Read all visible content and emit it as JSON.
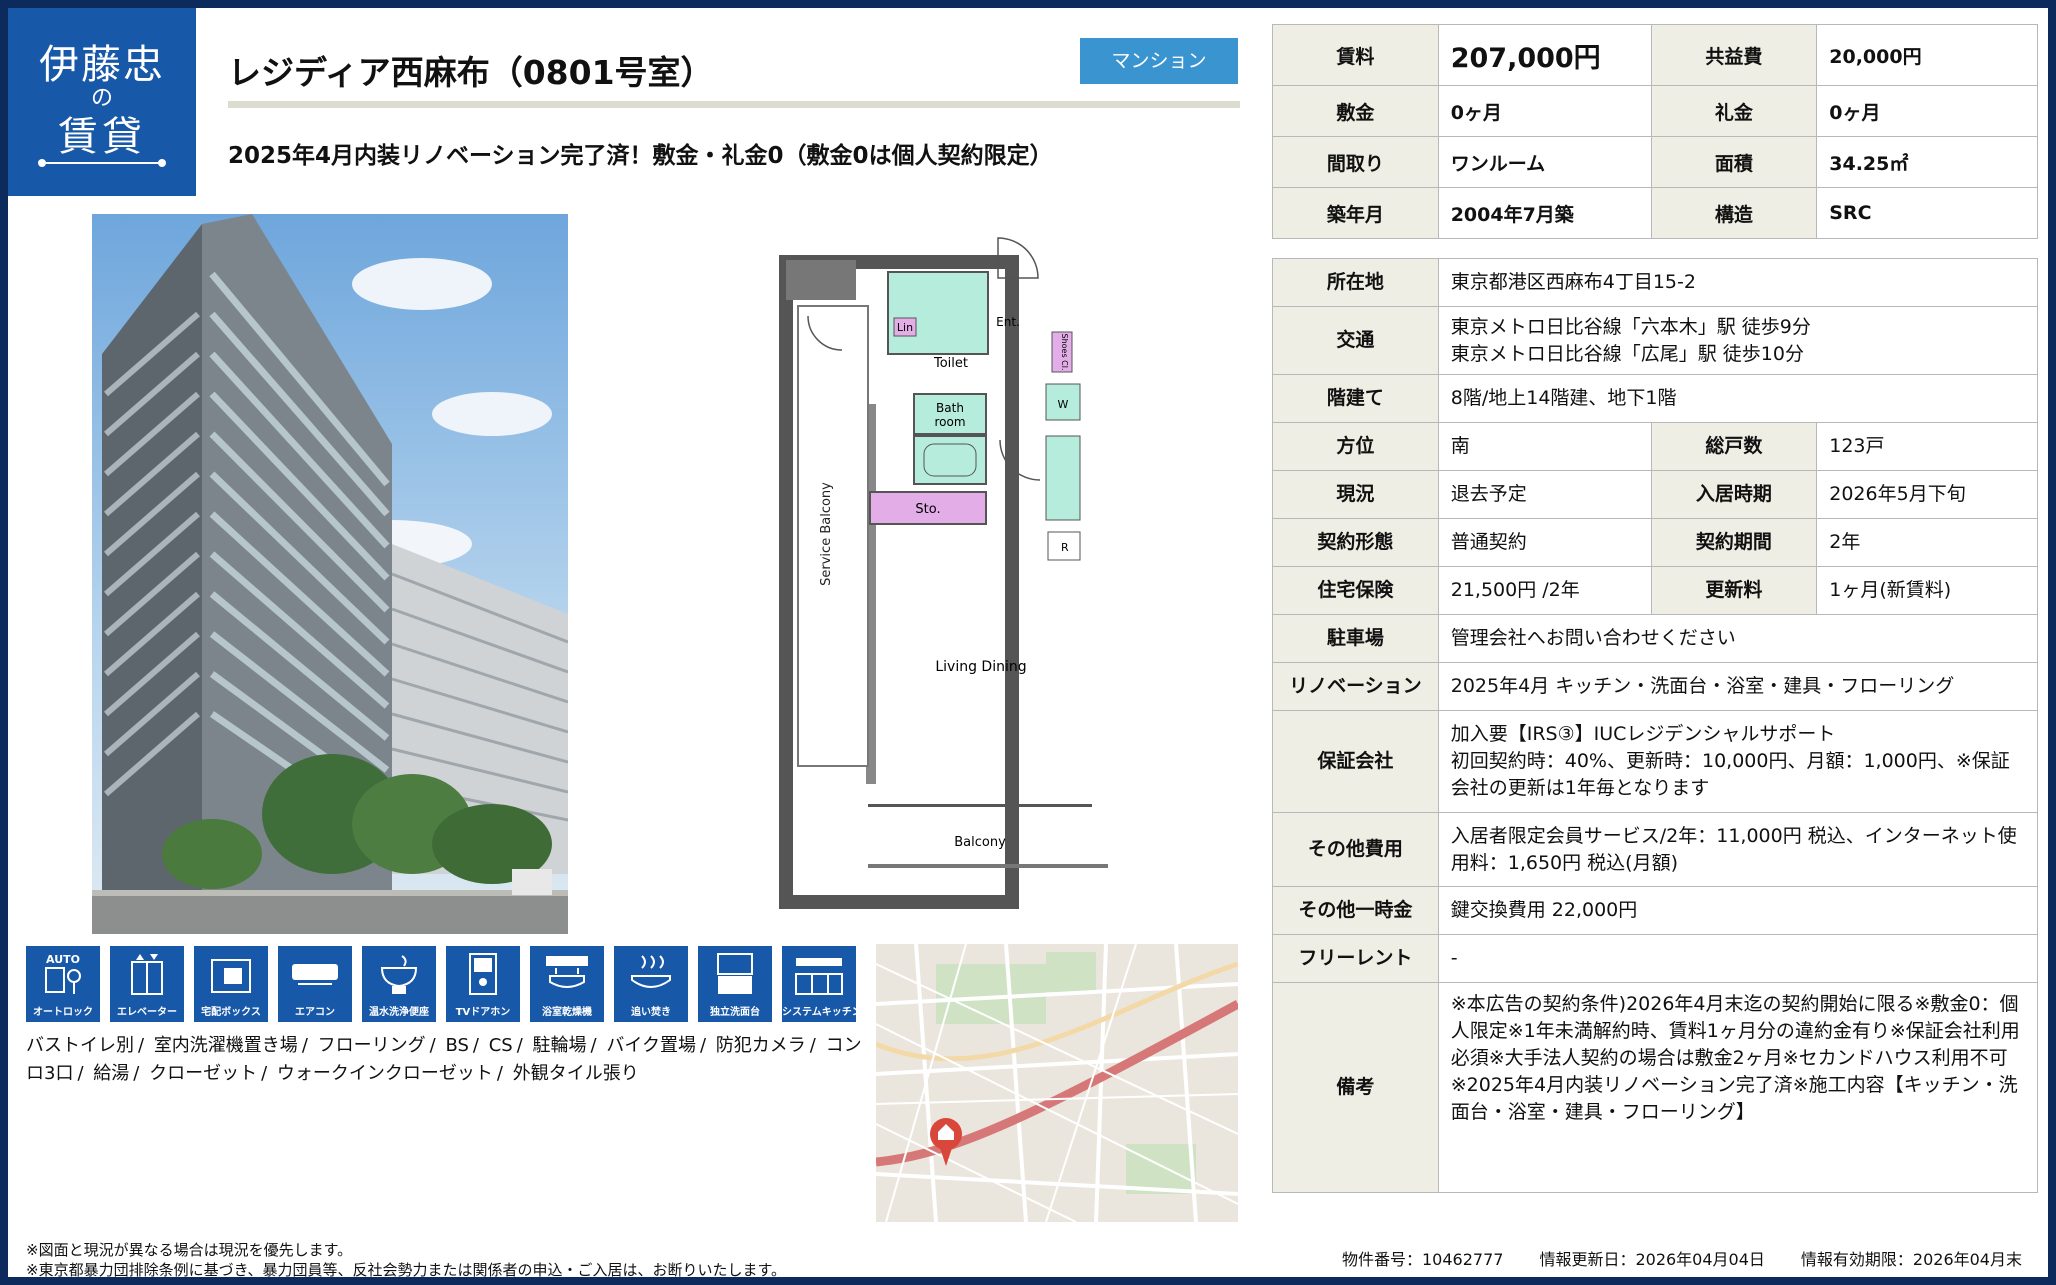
{
  "logo": {
    "line1": "伊藤忠",
    "line2": "の",
    "line3": "賃貸"
  },
  "title": "レジディア西麻布（0801号室）",
  "badge": "マンション",
  "subtitle": "2025年4月内装リノベーション完了済！敷金・礼金0（敷金0は個人契約限定）",
  "floorplan": {
    "lin": "Lin",
    "ent": "Ent.",
    "toilet": "Toilet",
    "shoes": "Shoes Cl.",
    "bath1": "Bath",
    "bath2": "room",
    "w": "W",
    "sto": "Sto.",
    "r": "R",
    "service_balcony": "Service Balcony",
    "living": "Living Dining",
    "balcony": "Balcony"
  },
  "amenities": [
    "オートロック",
    "エレベーター",
    "宅配ボックス",
    "エアコン",
    "温水洗浄便座",
    "TVドアホン",
    "浴室乾燥機",
    "追い焚き",
    "独立洗面台",
    "システムキッチン"
  ],
  "amenity_icons": [
    "auto-lock-icon",
    "elevator-icon",
    "delivery-box-icon",
    "air-conditioner-icon",
    "washlet-icon",
    "tv-intercom-icon",
    "bathroom-dryer-icon",
    "reheat-bath-icon",
    "vanity-icon",
    "system-kitchen-icon"
  ],
  "auto_text": "AUTO",
  "features": [
    "バストイレ別",
    "室内洗濯機置き場",
    "フローリング",
    "BS",
    "CS",
    "駐輪場",
    "バイク置場",
    "防犯カメラ",
    "コンロ3口",
    "給湯",
    "クローゼット",
    "ウォークインクローゼット",
    "外観タイル張り"
  ],
  "feature_sep": "/",
  "summary": {
    "rent_label": "賃料",
    "rent": "207,000円",
    "fee_label": "共益費",
    "fee": "20,000円",
    "deposit_label": "敷金",
    "deposit": "0ヶ月",
    "key_money_label": "礼金",
    "key_money": "0ヶ月",
    "layout_label": "間取り",
    "layout": "ワンルーム",
    "area_label": "面積",
    "area": "34.25㎡",
    "built_label": "築年月",
    "built": "2004年7月築",
    "structure_label": "構造",
    "structure": "SRC"
  },
  "details": {
    "address_label": "所在地",
    "address": "東京都港区西麻布4丁目15-2",
    "access_label": "交通",
    "access1": "東京メトロ日比谷線「六本木」駅 徒歩9分",
    "access2": "東京メトロ日比谷線「広尾」駅 徒歩10分",
    "floor_label": "階建て",
    "floor": "8階/地上14階建、地下1階",
    "direction_label": "方位",
    "direction": "南",
    "units_label": "総戸数",
    "units": "123戸",
    "status_label": "現況",
    "status": "退去予定",
    "movein_label": "入居時期",
    "movein": "2026年5月下旬",
    "contract_label": "契約形態",
    "contract": "普通契約",
    "period_label": "契約期間",
    "period": "2年",
    "insurance_label": "住宅保険",
    "insurance": "21,500円 /2年",
    "renewal_label": "更新料",
    "renewal": "1ヶ月(新賃料)",
    "parking_label": "駐車場",
    "parking": "管理会社へお問い合わせください",
    "renovation_label": "リノベーション",
    "renovation": "2025年4月 キッチン・洗面台・浴室・建具・フローリング",
    "guarantor_label": "保証会社",
    "guarantor1": "加入要【IRS③】IUCレジデンシャルサポート",
    "guarantor2": "初回契約時：40%、更新時：10,000円、月額：1,000円、※保証会社の更新は1年毎となります",
    "other_fees_label": "その他費用",
    "other_fees": "入居者限定会員サービス/2年：11,000円 税込、インターネット使用料：1,650円 税込(月額)",
    "onetime_label": "その他一時金",
    "onetime": "鍵交換費用 22,000円",
    "freerent_label": "フリーレント",
    "freerent": "-",
    "remarks_label": "備考",
    "remarks": "※本広告の契約条件)2026年4月末迄の契約開始に限る※敷金0：個人限定※1年未満解約時、賃料1ヶ月分の違約金有り※保証会社利用必須※大手法人契約の場合は敷金2ヶ月※セカンドハウス利用不可※2025年4月内装リノベーション完了済※施工内容【キッチン・洗面台・浴室・建具・フローリング】"
  },
  "footnote1": "※図面と現況が異なる場合は現況を優先します。",
  "footnote2": "※東京都暴力団排除条例に基づき、暴力団員等、反社会勢力または関係者の申込・ご入居は、お断りいたします。",
  "property_no": "物件番号：10462777",
  "updated": "情報更新日：2026年04月04日",
  "valid_until": "情報有効期限：2026年04月末",
  "colors": {
    "brand_blue": "#1858a8",
    "badge_blue": "#3a94d0",
    "header_cell": "#eeeee4",
    "border": "#b8b8b8"
  }
}
